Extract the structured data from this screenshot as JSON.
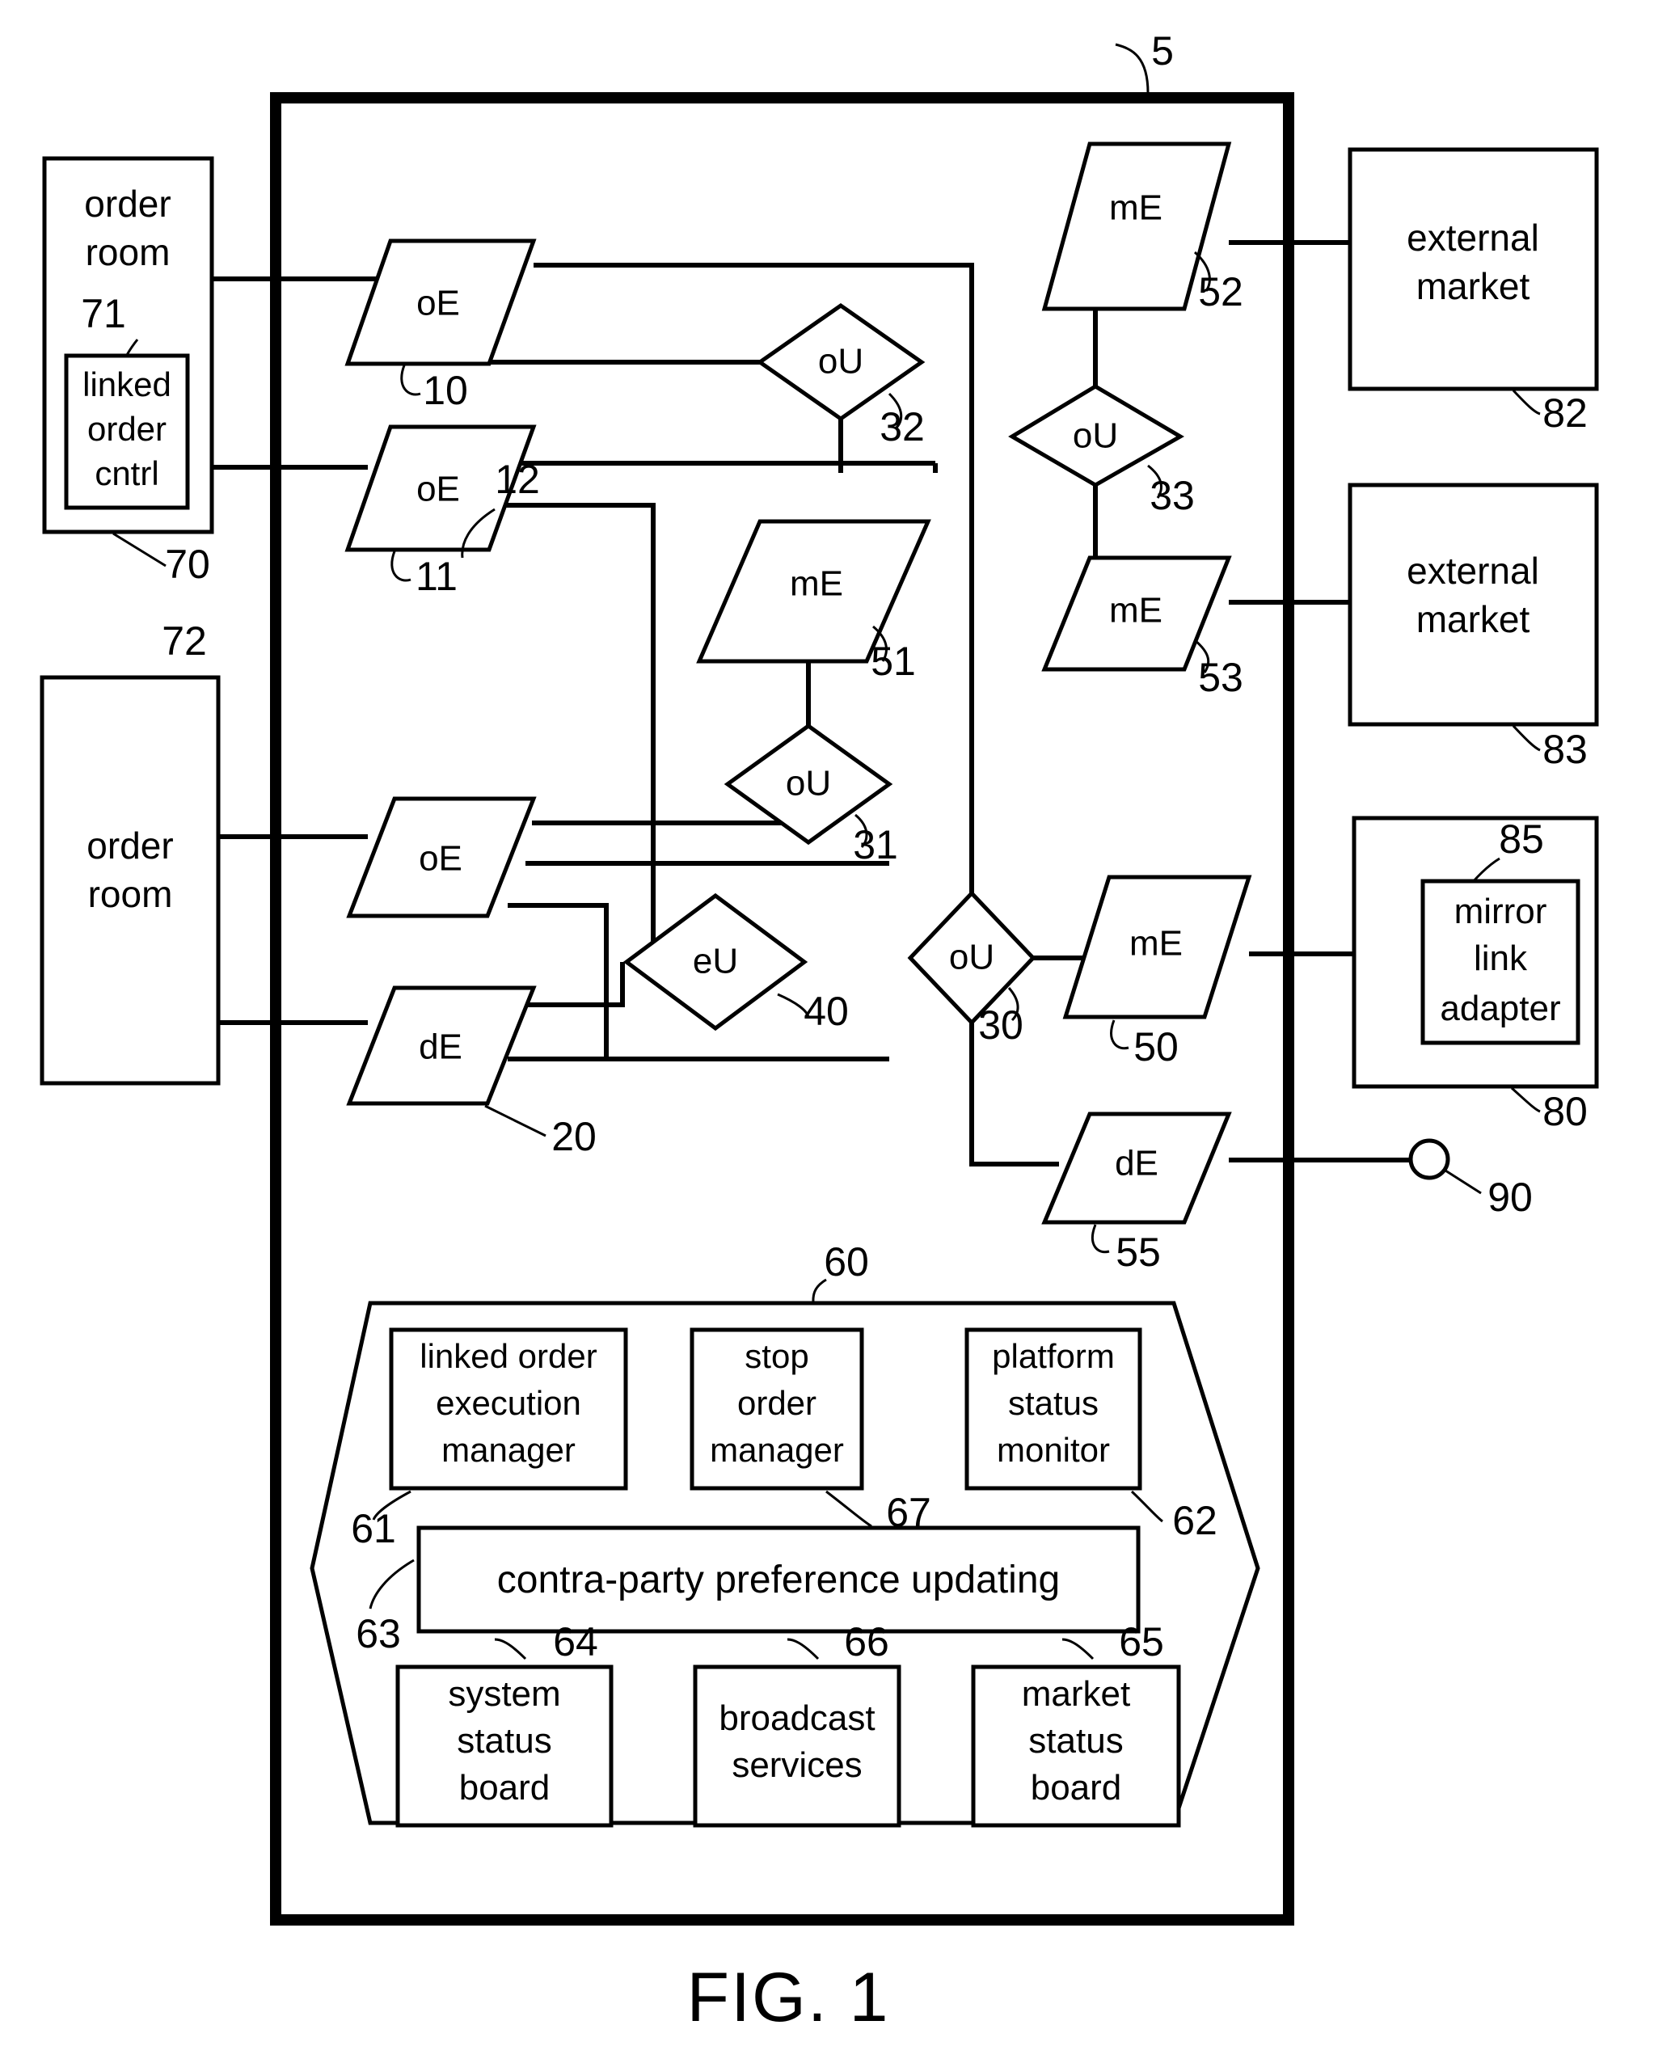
{
  "figure": {
    "caption": "FIG. 1",
    "system_ref": "5"
  },
  "platform_frame": {
    "ref": "5"
  },
  "order_rooms": [
    {
      "id": "order-room-70",
      "label_line1": "order",
      "label_line2": "room",
      "ref": "70",
      "inner_module": {
        "id": "linked-order-cntrl-71",
        "label_line1": "linked",
        "label_line2": "order",
        "label_line3": "cntrl",
        "ref": "71"
      }
    },
    {
      "id": "order-room-72",
      "label_line1": "order",
      "label_line2": "room",
      "ref": "72"
    }
  ],
  "order_engines": [
    {
      "id": "oE-10",
      "label": "oE",
      "ref": "10"
    },
    {
      "id": "oE-11",
      "label": "oE",
      "ref": "11"
    },
    {
      "id": "oE-12",
      "label": "oE",
      "ref": "12"
    }
  ],
  "data_engines": [
    {
      "id": "dE-20",
      "label": "dE",
      "ref": "20"
    },
    {
      "id": "dE-55",
      "label": "dE",
      "ref": "55"
    }
  ],
  "order_update_units": [
    {
      "id": "oU-30",
      "label": "oU",
      "ref": "30"
    },
    {
      "id": "oU-31",
      "label": "oU",
      "ref": "31"
    },
    {
      "id": "oU-32",
      "label": "oU",
      "ref": "32"
    },
    {
      "id": "oU-33",
      "label": "oU",
      "ref": "33"
    }
  ],
  "execution_update_units": [
    {
      "id": "eU-40",
      "label": "eU",
      "ref": "40"
    }
  ],
  "market_engines": [
    {
      "id": "mE-50",
      "label": "mE",
      "ref": "50"
    },
    {
      "id": "mE-51",
      "label": "mE",
      "ref": "51"
    },
    {
      "id": "mE-52",
      "label": "mE",
      "ref": "52"
    },
    {
      "id": "mE-53",
      "label": "mE",
      "ref": "53"
    }
  ],
  "external_systems": [
    {
      "id": "external-market-82",
      "label_line1": "external",
      "label_line2": "market",
      "ref": "82"
    },
    {
      "id": "external-market-83",
      "label_line1": "external",
      "label_line2": "market",
      "ref": "83"
    },
    {
      "id": "mirror-link-host-80",
      "ref": "80",
      "inner_module": {
        "id": "mirror-link-adapter-85",
        "label_line1": "mirror",
        "label_line2": "link",
        "label_line3": "adapter",
        "ref": "85"
      }
    }
  ],
  "terminal_node": {
    "id": "node-90",
    "ref": "90"
  },
  "services_region": {
    "ref": "60",
    "modules": [
      {
        "id": "linked-order-execution-manager",
        "lines": [
          "linked order",
          "execution",
          "manager"
        ],
        "ref": "61"
      },
      {
        "id": "stop-order-manager",
        "lines": [
          "stop",
          "order",
          "manager"
        ],
        "ref": "67"
      },
      {
        "id": "platform-status-monitor",
        "lines": [
          "platform",
          "status",
          "monitor"
        ],
        "ref": "62"
      },
      {
        "id": "contra-party-preference-updating",
        "lines": [
          "contra-party preference updating"
        ],
        "ref": "63"
      },
      {
        "id": "system-status-board",
        "lines": [
          "system",
          "status",
          "board"
        ],
        "ref": "64"
      },
      {
        "id": "broadcast-services",
        "lines": [
          "broadcast",
          "services"
        ],
        "ref": "66"
      },
      {
        "id": "market-status-board",
        "lines": [
          "market",
          "status",
          "board"
        ],
        "ref": "65"
      }
    ]
  },
  "colors": {
    "line": "#000000",
    "background": "#ffffff"
  }
}
